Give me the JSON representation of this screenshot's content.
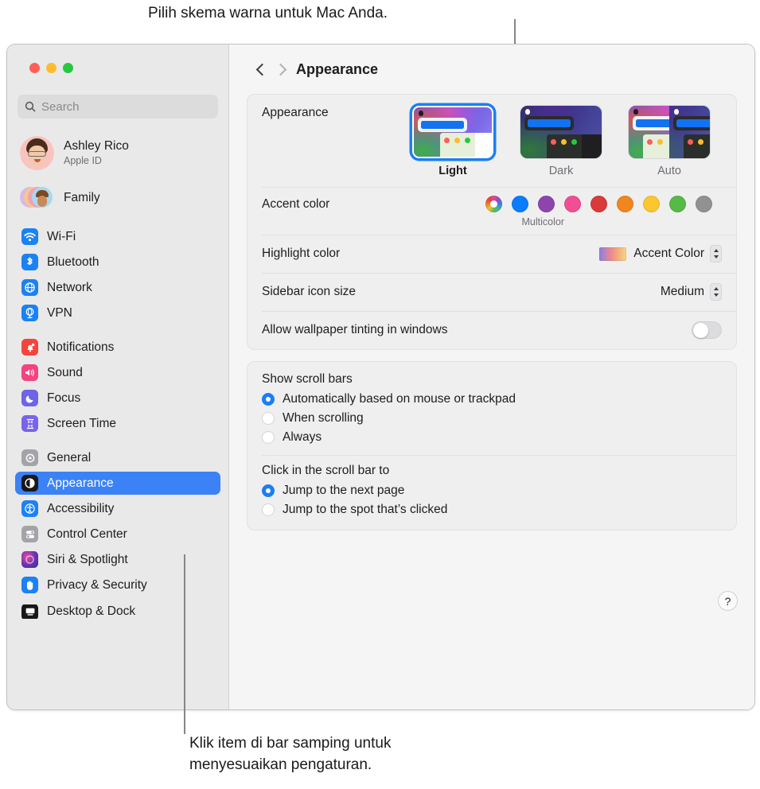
{
  "callouts": {
    "top": "Pilih skema warna untuk Mac Anda.",
    "bottom_line1": "Klik item di bar samping untuk",
    "bottom_line2": "menyesuaikan pengaturan."
  },
  "window": {
    "title": "Appearance",
    "back_icon": "chevron-left-icon",
    "forward_icon": "chevron-right-icon",
    "help_label": "?"
  },
  "sidebar": {
    "search": {
      "placeholder": "Search",
      "icon": "search-icon"
    },
    "profile": {
      "name": "Ashley Rico",
      "subtitle": "Apple ID",
      "avatar": "memoji-avatar"
    },
    "family": {
      "label": "Family",
      "icon": "family-avatars-icon"
    },
    "group1": [
      {
        "label": "Wi-Fi",
        "icon": "wifi-icon"
      },
      {
        "label": "Bluetooth",
        "icon": "bluetooth-icon"
      },
      {
        "label": "Network",
        "icon": "network-globe-icon"
      },
      {
        "label": "VPN",
        "icon": "vpn-icon"
      }
    ],
    "group2": [
      {
        "label": "Notifications",
        "icon": "bell-icon"
      },
      {
        "label": "Sound",
        "icon": "speaker-icon"
      },
      {
        "label": "Focus",
        "icon": "moon-icon"
      },
      {
        "label": "Screen Time",
        "icon": "hourglass-icon"
      }
    ],
    "group3": [
      {
        "label": "General",
        "icon": "gear-icon"
      },
      {
        "label": "Appearance",
        "icon": "appearance-contrast-icon",
        "selected": true
      },
      {
        "label": "Accessibility",
        "icon": "accessibility-icon"
      },
      {
        "label": "Control Center",
        "icon": "control-center-icon"
      },
      {
        "label": "Siri & Spotlight",
        "icon": "siri-icon"
      },
      {
        "label": "Privacy & Security",
        "icon": "hand-privacy-icon"
      }
    ],
    "clipped": {
      "label": "Desktop & Dock",
      "icon": "desktop-dock-icon"
    }
  },
  "main": {
    "appearance": {
      "label": "Appearance",
      "options": [
        {
          "name": "Light",
          "selected": true
        },
        {
          "name": "Dark",
          "selected": false
        },
        {
          "name": "Auto",
          "selected": false
        }
      ]
    },
    "accent": {
      "label": "Accent color",
      "caption": "Multicolor",
      "swatches": [
        {
          "name": "multicolor",
          "color": "multi"
        },
        {
          "name": "blue",
          "color": "#0a7cff"
        },
        {
          "name": "purple",
          "color": "#8e44ad"
        },
        {
          "name": "pink",
          "color": "#f14e93"
        },
        {
          "name": "red",
          "color": "#d93a3a"
        },
        {
          "name": "orange",
          "color": "#f0871e"
        },
        {
          "name": "yellow",
          "color": "#fbc62f"
        },
        {
          "name": "green",
          "color": "#57b947"
        },
        {
          "name": "graphite",
          "color": "#919191"
        }
      ]
    },
    "highlight": {
      "label": "Highlight color",
      "value": "Accent Color"
    },
    "sidebar_icon_size": {
      "label": "Sidebar icon size",
      "value": "Medium"
    },
    "wallpaper_tinting": {
      "label": "Allow wallpaper tinting in windows",
      "enabled": false
    },
    "scroll_bars": {
      "title": "Show scroll bars",
      "options": [
        {
          "label": "Automatically based on mouse or trackpad",
          "selected": true
        },
        {
          "label": "When scrolling",
          "selected": false
        },
        {
          "label": "Always",
          "selected": false
        }
      ]
    },
    "scroll_click": {
      "title": "Click in the scroll bar to",
      "options": [
        {
          "label": "Jump to the next page",
          "selected": true
        },
        {
          "label": "Jump to the spot that’s clicked",
          "selected": false
        }
      ]
    }
  }
}
